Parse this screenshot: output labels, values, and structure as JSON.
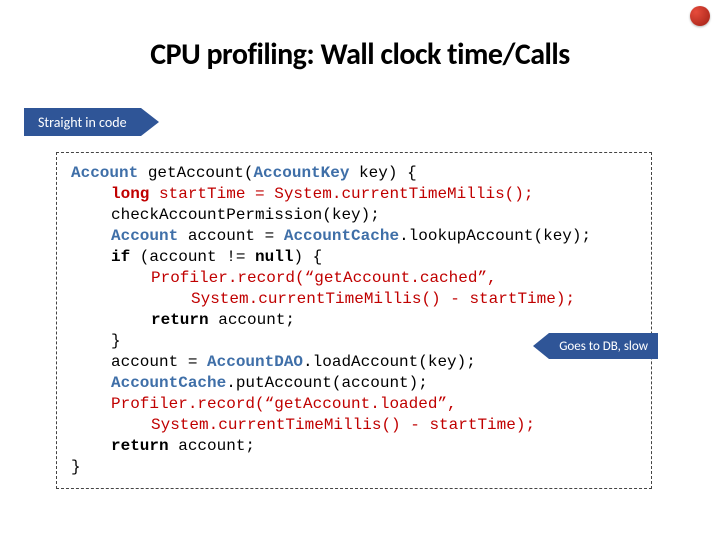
{
  "title": "CPU profiling: Wall clock time/Calls",
  "tags": {
    "left": "Straight in code",
    "right": "Goes to DB, slow"
  },
  "code": {
    "tAccount": "Account",
    "tAccountKey": "AccountKey",
    "tAccountCache": "AccountCache",
    "tAccountDAO": "AccountDAO",
    "kwLong": "long",
    "kwIf": "if",
    "kwNull": "null",
    "kwReturn": "return",
    "sig_getAccount": " getAccount(",
    "sig_keyParen": " key) {",
    "l2_rest": " startTime = System.currentTimeMillis();",
    "l3": "checkAccountPermission(key);",
    "l4_a": " account = ",
    "l4_b": ".lookupAccount(key);",
    "l5_a": " (account != ",
    "l5_b": ") {",
    "l6": "Profiler.record(“getAccount.cached”,",
    "l7": "System.currentTimeMillis() - startTime);",
    "l8_rest": " account;",
    "l9": "}",
    "l10_a": "account = ",
    "l10_b": ".loadAccount(key);",
    "l11_b": ".putAccount(account);",
    "l12": "Profiler.record(“getAccount.loaded”,",
    "l13": "System.currentTimeMillis() - startTime);",
    "l14_rest": " account;",
    "l15": "}"
  }
}
